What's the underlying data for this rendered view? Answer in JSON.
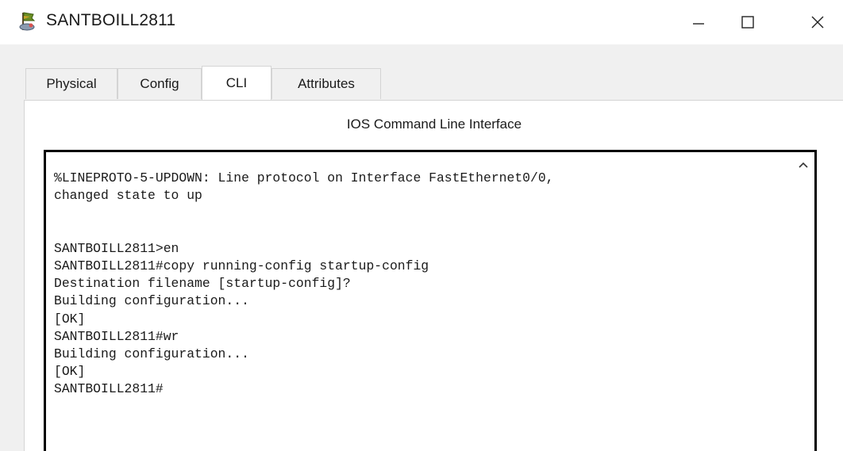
{
  "window": {
    "title": "SANTBOILL2811",
    "icon": "router-device-icon",
    "controls": {
      "minimize": "minimize-icon",
      "maximize": "maximize-icon",
      "close": "close-icon"
    }
  },
  "tabs": [
    {
      "label": "Physical",
      "active": false
    },
    {
      "label": "Config",
      "active": false
    },
    {
      "label": "CLI",
      "active": true
    },
    {
      "label": "Attributes",
      "active": false
    }
  ],
  "cli": {
    "heading": "IOS Command Line Interface",
    "console_lines": [
      "%LINEPROTO-5-UPDOWN: Line protocol on Interface FastEthernet0/0,",
      "changed state to up",
      "",
      "",
      "SANTBOILL2811>en",
      "SANTBOILL2811#copy running-config startup-config",
      "Destination filename [startup-config]?",
      "Building configuration...",
      "[OK]",
      "SANTBOILL2811#wr",
      "Building configuration...",
      "[OK]",
      "SANTBOILL2811#"
    ]
  },
  "colors": {
    "panel_background": "#f0f0f0",
    "terminal_border": "#000000",
    "text": "#1a1a1a"
  }
}
